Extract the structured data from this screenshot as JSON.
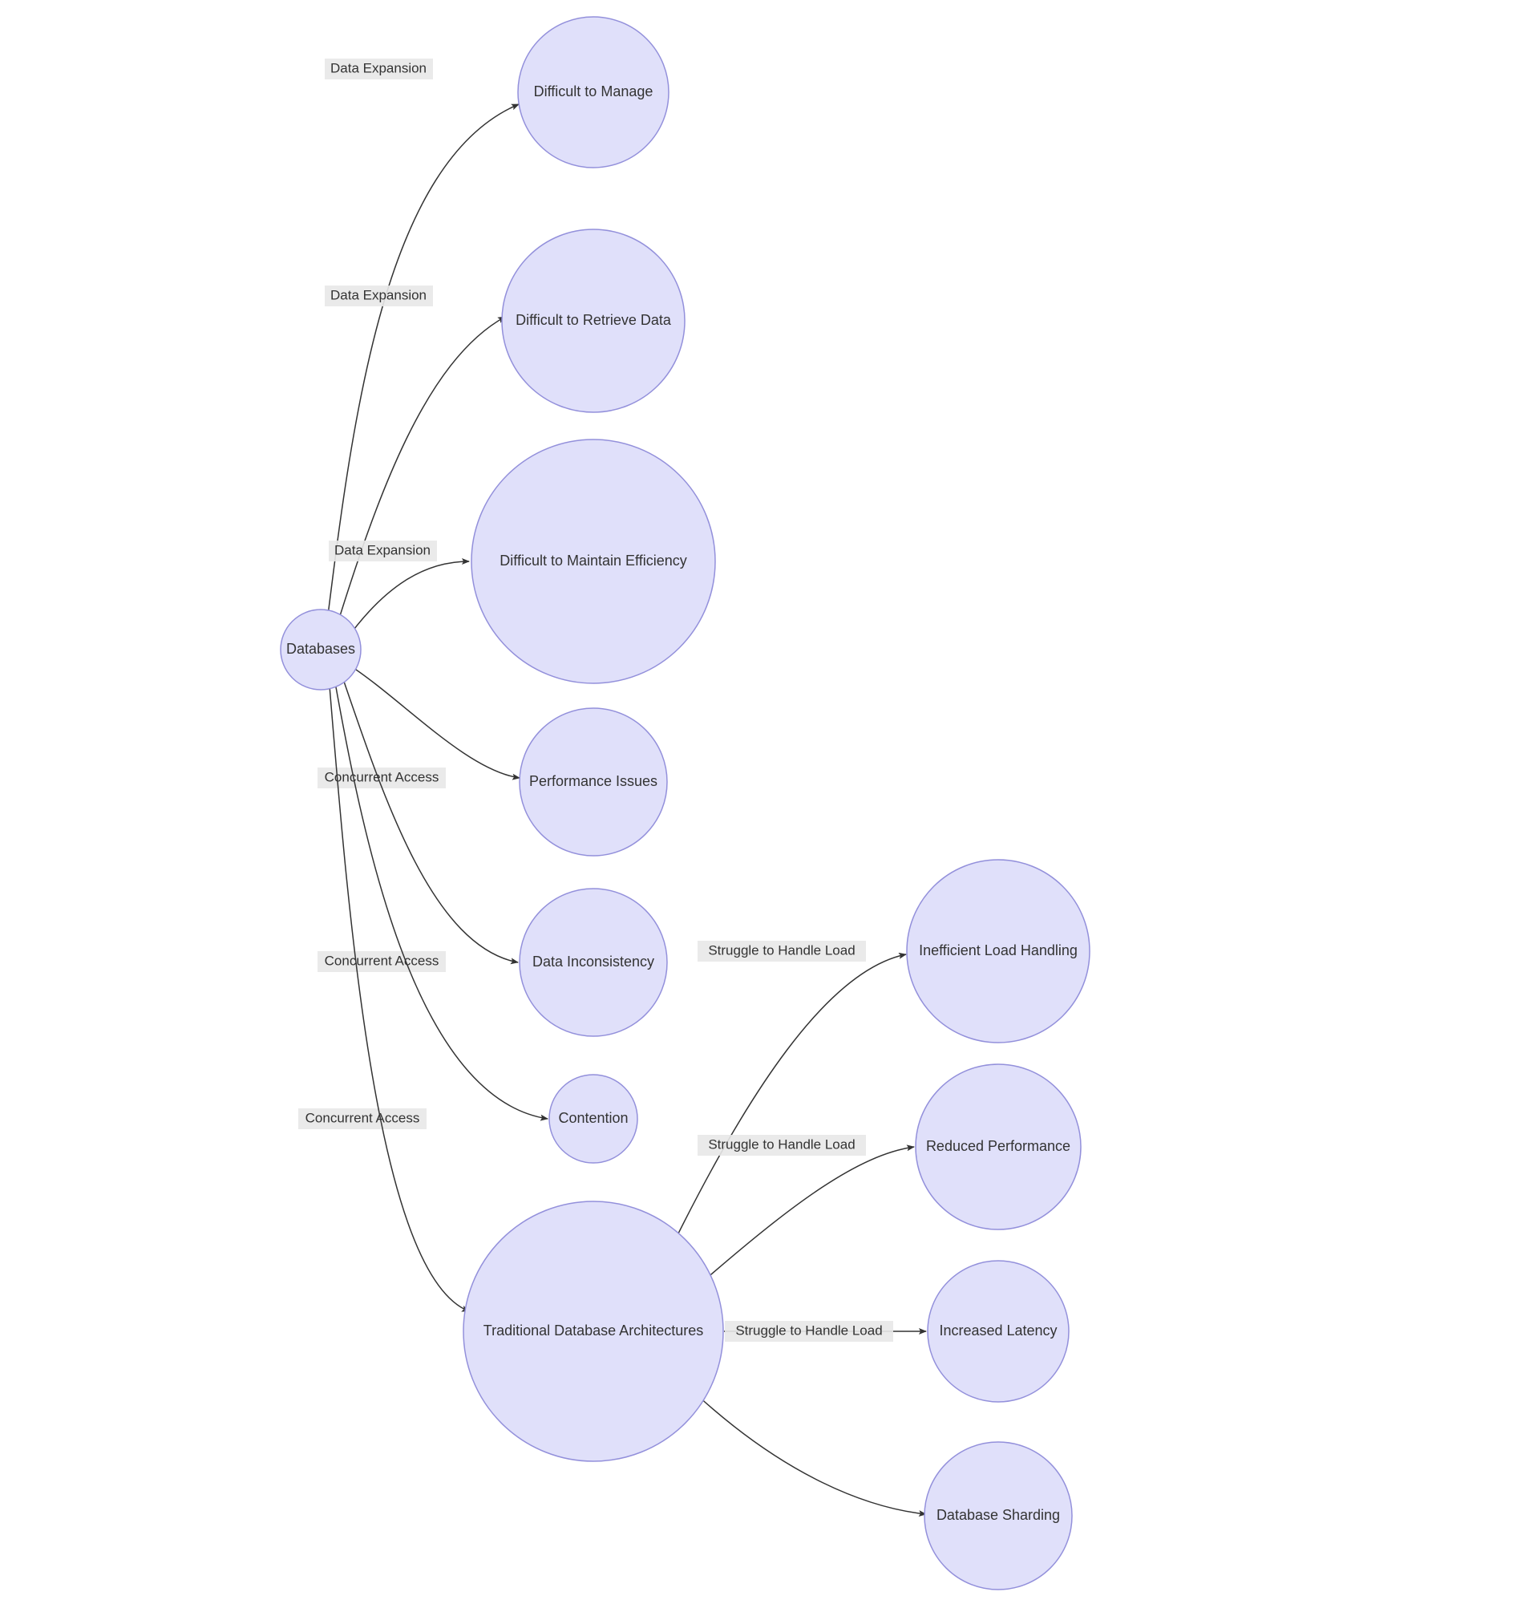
{
  "colors": {
    "node_fill": "#E0E0FA",
    "node_stroke": "#9390DB",
    "edge_stroke": "#333333",
    "edge_label_bg": "#E8E8E8",
    "text": "#333333"
  },
  "nodes": {
    "databases": {
      "label": "Databases"
    },
    "difficult_manage": {
      "label": "Difficult to Manage"
    },
    "difficult_retrieve": {
      "label": "Difficult to Retrieve Data"
    },
    "difficult_efficiency": {
      "label": "Difficult to Maintain Efficiency"
    },
    "performance_issues": {
      "label": "Performance Issues"
    },
    "data_inconsistency": {
      "label": "Data Inconsistency"
    },
    "contention": {
      "label": "Contention"
    },
    "traditional_arch": {
      "label": "Traditional Database Architectures"
    },
    "inefficient_load": {
      "label": "Inefficient Load Handling"
    },
    "reduced_perf": {
      "label": "Reduced Performance"
    },
    "increased_latency": {
      "label": "Increased Latency"
    },
    "db_sharding": {
      "label": "Database Sharding"
    }
  },
  "edges": {
    "e1": {
      "label": "Data Expansion"
    },
    "e2": {
      "label": "Data Expansion"
    },
    "e3": {
      "label": "Data Expansion"
    },
    "e4": {
      "label": "Concurrent Access"
    },
    "e5": {
      "label": "Concurrent Access"
    },
    "e6": {
      "label": "Concurrent Access"
    },
    "e7": {
      "label": ""
    },
    "e8": {
      "label": "Struggle to Handle Load"
    },
    "e9": {
      "label": "Struggle to Handle Load"
    },
    "e10": {
      "label": "Struggle to Handle Load"
    },
    "e11": {
      "label": ""
    }
  }
}
